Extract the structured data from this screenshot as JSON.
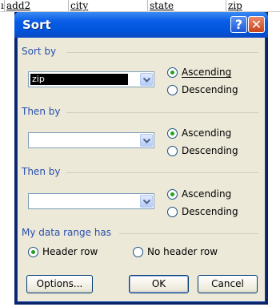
{
  "sheet": {
    "columns": [
      "add2",
      "city",
      "state",
      "zip"
    ],
    "row_marker": "ı"
  },
  "dialog": {
    "title": "Sort",
    "help_glyph": "?",
    "close_glyph": "✕",
    "sort_by": {
      "label": "Sort by",
      "value": "zip",
      "ascending": "Ascending",
      "descending": "Descending",
      "selected": "ascending"
    },
    "then_by_1": {
      "label": "Then by",
      "value": "",
      "ascending": "Ascending",
      "descending": "Descending",
      "selected": "ascending"
    },
    "then_by_2": {
      "label": "Then by",
      "value": "",
      "ascending": "Ascending",
      "descending": "Descending",
      "selected": "ascending"
    },
    "range": {
      "label": "My data range has",
      "header_row": "Header row",
      "no_header_row": "No header row",
      "selected": "header_row"
    },
    "buttons": {
      "options": "Options...",
      "ok": "OK",
      "cancel": "Cancel"
    }
  },
  "colors": {
    "title_bar": "#0a5de6",
    "group_label": "#2a4fae",
    "dialog_bg": "#ece9d8",
    "radio_dot": "#21a121"
  }
}
